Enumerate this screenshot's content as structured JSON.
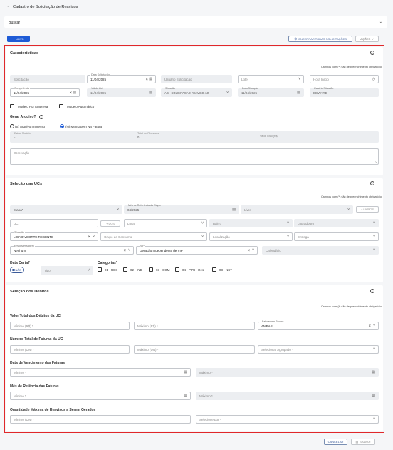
{
  "header": {
    "back_icon": "arrow-left-icon",
    "title": "Cadastro de Solicitação de Reavisos"
  },
  "search": {
    "label": "Buscar"
  },
  "toolbar": {
    "new_label": "+ NOVO",
    "close_all_label": "ENCERRAR TODAS SOLICITAÇÕES",
    "actions_label": "AÇÕES"
  },
  "required_note": "Campos com (*) são de preenchimento obrigatório",
  "caracteristicas": {
    "title": "Características",
    "solicitacao_ph": "Solicitação",
    "data_solicitacao": {
      "label": "Data Solicitação",
      "value": "11/04/2025"
    },
    "usuario_solicitacao_ph": "Usuário Solicitação",
    "lote_ph": "Lote",
    "hora_inicio_ph": "Hora Início",
    "competencia": {
      "label": "Competência",
      "value": "11/04/2025"
    },
    "valido_ate": {
      "label": "Válido Até",
      "value": "11/04/2025"
    },
    "situacao": {
      "label": "Situação",
      "value": "AG - SOLICITACAO REAVISO AG"
    },
    "data_situacao": {
      "label": "Data Situação",
      "value": "11/04/2025"
    },
    "usuario_situacao": {
      "label": "Usuário Situação",
      "value": "EDWARD"
    },
    "modelo_por_empresa": "Modelo Por Empresa",
    "modelo_automatico": "Modelo Automático",
    "gerar_arquivo": "Gerar Arquivo?",
    "radio_s": "(S) Arquivo Impresso",
    "radio_n": "(N) Mensagem Na Fatura",
    "estr_modelo": {
      "label": "Estru. Modelo",
      "value": "-"
    },
    "total_reavisos": {
      "label": "Total de Reavisos",
      "value": "0"
    },
    "valor_total": {
      "label": "Valor Total (R$)"
    },
    "observacao_ph": "Observação"
  },
  "ucs": {
    "title": "Seleção das UCs",
    "etapa_ph": "Etapa*",
    "mes_ref": {
      "label": "Mês de Referência da Etapa",
      "value": "04/2025"
    },
    "livro_ph": "Livro",
    "livros_btn": "+ LIVROS",
    "uc_ph": "UC",
    "ucs_btn": "+ UCS",
    "local_ph": "Local",
    "bairro_ph": "Bairro",
    "logradouro_ph": "Logradouro",
    "situacao": {
      "label": "Situação",
      "value": "LIGADA/CORTE RECENTE"
    },
    "grupo_consumo_ph": "Grupo de Consumo",
    "localizacao_ph": "Localização",
    "entrega_ph": "Entrega",
    "envio_mensagem": {
      "label": "Envio Mensagem",
      "value": "Nenhum"
    },
    "vip": {
      "label": "VIP",
      "value": "Geração Independente de VIP"
    },
    "calendario_ph": "Calendário",
    "data_certa": "Data Certa?",
    "toggle_label": "NÃO",
    "tipo_ph": "Tipo",
    "categorias": "Categorias*",
    "cats": [
      "01 - RES",
      "02 - IND",
      "03 - COM",
      "04 - PPU - Res",
      "08 - NST"
    ]
  },
  "debitos": {
    "title": "Seleção dos Débitos",
    "valor_total": "Valor Total dos Débitos da UC",
    "min_rs": "Mínimo (R$) *",
    "max_rs": "Máximo (R$) *",
    "faturas_perdas": {
      "label": "Faturas em Perdas",
      "value": "AMBAS"
    },
    "num_total": "Número Total de Faturas da UC",
    "min_un": "Mínimo (UN) *",
    "max_un": "Máximo (UN) *",
    "sel_agrupado": "Selecionar Agrupado *",
    "data_venc": "Data de Vencimento das Faturas",
    "min": "Mínimo *",
    "max": "Máximo *",
    "mes_ref": "Mês de Refência das Faturas",
    "qtd_max": "Quantidade Máxima de Reavisos a Serem Gerados",
    "selecione_por": "Selecione por *"
  },
  "footer": {
    "cancel": "CANCELAR",
    "save": "SALVAR"
  }
}
